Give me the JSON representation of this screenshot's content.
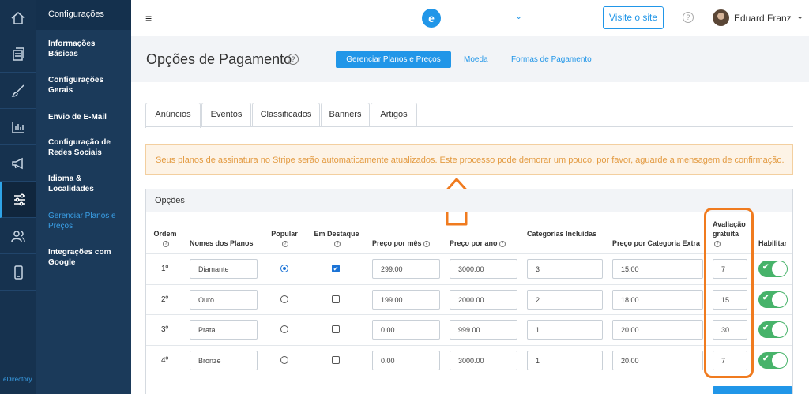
{
  "brand": {
    "rail_label": "eDirectory",
    "logo_letter": "e"
  },
  "rail": [
    "home-icon",
    "pages-icon",
    "brush-icon",
    "chart-icon",
    "megaphone-icon",
    "sliders-icon",
    "users-icon",
    "mobile-icon"
  ],
  "menu": {
    "title": "Configurações",
    "items": [
      {
        "label": "Informações Básicas"
      },
      {
        "label": "Configurações Gerais"
      },
      {
        "label": "Envio de E-Mail"
      },
      {
        "label": "Configuração de Redes Sociais"
      },
      {
        "label": "Idioma & Localidades"
      },
      {
        "label": "Gerenciar Planos e Preços"
      },
      {
        "label": "Integrações com Google"
      }
    ]
  },
  "topbar": {
    "menu_glyph": "≡",
    "visit_label": "Visite o site",
    "help_glyph": "?",
    "user_name": "Eduard Franz",
    "caret": "⌄"
  },
  "page": {
    "title": "Opções de Pagamento",
    "help_glyph": "?",
    "tabs": [
      "Gerenciar Planos e Preços",
      "Moeda",
      "Formas de Pagamento"
    ]
  },
  "content_tabs": [
    "Anúncios",
    "Eventos",
    "Classificados",
    "Banners",
    "Artigos"
  ],
  "alert": "Seus planos de assinatura no Stripe serão automaticamente atualizados. Este processo pode demorar um pouco, por favor, aguarde a mensagem de confirmação.",
  "panel": {
    "title": "Opções",
    "headers": {
      "ordem": "Ordem",
      "nomes": "Nomes dos Planos",
      "popular": "Popular",
      "destaque": "Em Destaque",
      "preco_mes": "Preço por mês",
      "preco_ano": "Preço por ano",
      "categorias": "Categorias Incluídas",
      "preco_cat": "Preço por Categoria Extra",
      "avaliacao": "Avaliação gratuita",
      "habilitar": "Habilitar"
    },
    "help_glyph": "?",
    "check_glyph": "✔",
    "rows": [
      {
        "order": "1º",
        "name": "Diamante",
        "popular": true,
        "featured": true,
        "monthly": "299.00",
        "yearly": "3000.00",
        "categories": "3",
        "extra": "15.00",
        "trial": "7",
        "enabled": true
      },
      {
        "order": "2º",
        "name": "Ouro",
        "popular": false,
        "featured": false,
        "monthly": "199.00",
        "yearly": "2000.00",
        "categories": "2",
        "extra": "18.00",
        "trial": "15",
        "enabled": true
      },
      {
        "order": "3º",
        "name": "Prata",
        "popular": false,
        "featured": false,
        "monthly": "0.00",
        "yearly": "999.00",
        "categories": "1",
        "extra": "20.00",
        "trial": "30",
        "enabled": true
      },
      {
        "order": "4º",
        "name": "Bronze",
        "popular": false,
        "featured": false,
        "monthly": "0.00",
        "yearly": "3000.00",
        "categories": "1",
        "extra": "20.00",
        "trial": "7",
        "enabled": true
      }
    ]
  },
  "colors": {
    "accent": "#2196e8",
    "annotation": "#f07b1f",
    "toggle_on": "#47b36a",
    "alert_text": "#e39b42"
  }
}
